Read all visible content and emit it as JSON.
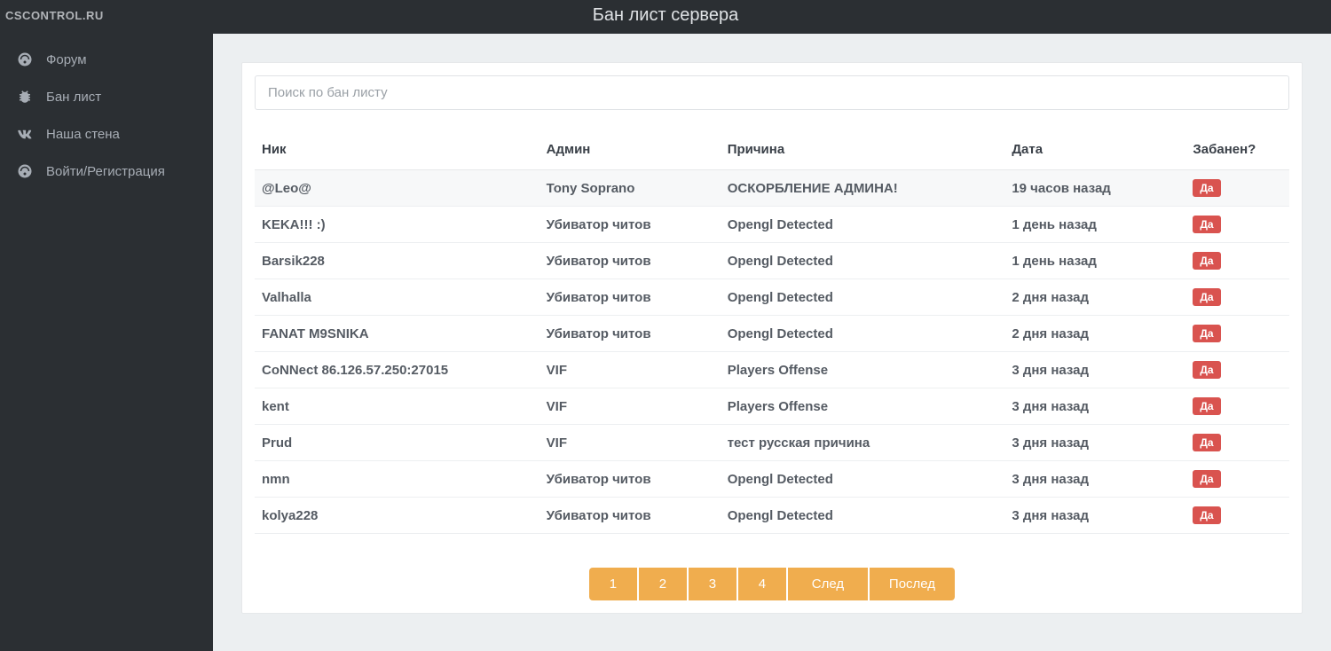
{
  "site": {
    "logo": "CSCONTROL.RU"
  },
  "header": {
    "title": "Бан лист сервера"
  },
  "sidebar": {
    "items": [
      {
        "icon": "dashboard",
        "label": "Форум"
      },
      {
        "icon": "bug",
        "label": "Бан лист"
      },
      {
        "icon": "vk",
        "label": "Наша стена"
      },
      {
        "icon": "dashboard",
        "label": "Войти/Регистрация"
      }
    ]
  },
  "search": {
    "placeholder": "Поиск по бан листу"
  },
  "table": {
    "headers": {
      "nick": "Ник",
      "admin": "Админ",
      "reason": "Причина",
      "date": "Дата",
      "banned": "Забанен?"
    },
    "rows": [
      {
        "nick": "@Leo@",
        "admin": "Tony Soprano",
        "reason": "ОСКОРБЛЕНИЕ АДМИНА!",
        "date": "19 часов назад",
        "banned": "Да",
        "highlight": true
      },
      {
        "nick": "KEKA!!! :)",
        "admin": "Убиватор читов",
        "reason": "Opengl Detected",
        "date": "1 день назад",
        "banned": "Да"
      },
      {
        "nick": "Barsik228",
        "admin": "Убиватор читов",
        "reason": "Opengl Detected",
        "date": "1 день назад",
        "banned": "Да"
      },
      {
        "nick": "Valhalla",
        "admin": "Убиватор читов",
        "reason": "Opengl Detected",
        "date": "2 дня назад",
        "banned": "Да"
      },
      {
        "nick": "FANAT M9SNIKA",
        "admin": "Убиватор читов",
        "reason": "Opengl Detected",
        "date": "2 дня назад",
        "banned": "Да"
      },
      {
        "nick": "CoNNect 86.126.57.250:27015",
        "admin": "VIF",
        "reason": "Players Offense",
        "date": "3 дня назад",
        "banned": "Да"
      },
      {
        "nick": "kent",
        "admin": "VIF",
        "reason": "Players Offense",
        "date": "3 дня назад",
        "banned": "Да"
      },
      {
        "nick": "Prud",
        "admin": "VIF",
        "reason": "тест русская причина",
        "date": "3 дня назад",
        "banned": "Да"
      },
      {
        "nick": "nmn",
        "admin": "Убиватор читов",
        "reason": "Opengl Detected",
        "date": "3 дня назад",
        "banned": "Да"
      },
      {
        "nick": "kolya228",
        "admin": "Убиватор читов",
        "reason": "Opengl Detected",
        "date": "3 дня назад",
        "banned": "Да"
      }
    ]
  },
  "pagination": {
    "pages": [
      "1",
      "2",
      "3",
      "4"
    ],
    "next": "След",
    "last": "Послед"
  }
}
